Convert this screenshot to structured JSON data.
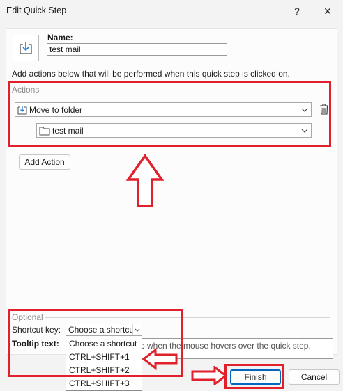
{
  "window": {
    "title": "Edit Quick Step",
    "help_label": "?",
    "close_label": "✕"
  },
  "name": {
    "label": "Name:",
    "value": "test mail"
  },
  "instructions": "Add actions below that will be performed when this quick step is clicked on.",
  "actions": {
    "group_title": "Actions",
    "action_select": "Move to folder",
    "folder_select": "test mail",
    "add_action_label": "Add Action"
  },
  "optional": {
    "group_title": "Optional",
    "shortcut_label": "Shortcut key:",
    "shortcut_value": "Choose a shortcut",
    "tooltip_label": "Tooltip text:",
    "tooltip_visible_text": "p when the mouse hovers over the quick step.",
    "shortcut_options": [
      "Choose a shortcut",
      "CTRL+SHIFT+1",
      "CTRL+SHIFT+2",
      "CTRL+SHIFT+3"
    ]
  },
  "footer": {
    "finish_label": "Finish",
    "cancel_label": "Cancel"
  },
  "annotation_color": "#e0202a",
  "icons": [
    "help-icon",
    "close-icon",
    "move-to-folder-icon",
    "folder-icon",
    "delete-icon",
    "chevron-down-icon"
  ]
}
